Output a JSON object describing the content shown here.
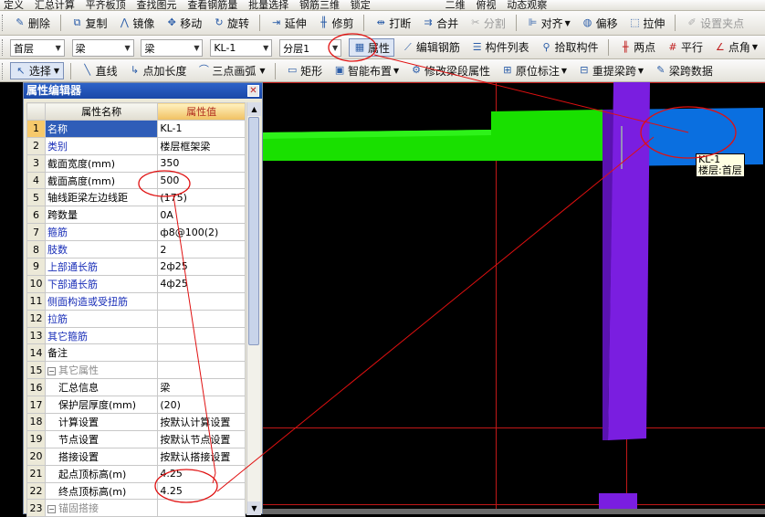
{
  "menu": [
    "定义",
    "汇总计算",
    "平齐板顶",
    "查找图元",
    "查看钢筋量",
    "批量选择",
    "钢筋三维",
    "锁定",
    "二维",
    "俯视",
    "动态观察"
  ],
  "toolbar1": {
    "delete": "删除",
    "copy": "复制",
    "mirror": "镜像",
    "move": "移动",
    "rotate": "旋转",
    "extend": "延伸",
    "trim": "修剪",
    "break": "打断",
    "merge": "合并",
    "split": "分割",
    "align": "对齐",
    "offset": "偏移",
    "stretch": "拉伸",
    "set_grip": "设置夹点"
  },
  "toolbar2": {
    "floor": "首层",
    "type1": "梁",
    "type2": "梁",
    "component": "KL-1",
    "layer": "分层1",
    "property": "属性",
    "edit_rebar": "编辑钢筋",
    "component_list": "构件列表",
    "pick": "拾取构件",
    "two_points": "两点",
    "parallel": "平行",
    "angle_point": "点角"
  },
  "toolbar3": {
    "select": "选择",
    "line": "直线",
    "point_extend": "点加长度",
    "arc": "三点画弧",
    "rect": "矩形",
    "smart": "智能布置",
    "modify_span": "修改梁段属性",
    "origin_mark": "原位标注",
    "re_span": "重提梁跨",
    "span_data": "梁跨数据"
  },
  "panel": {
    "title": "属性编辑器",
    "col_name": "属性名称",
    "col_value": "属性值",
    "rows": [
      {
        "n": "1",
        "name": "名称",
        "value": "KL-1",
        "style": "sel"
      },
      {
        "n": "2",
        "name": "类别",
        "value": "楼层框架梁",
        "style": "blue"
      },
      {
        "n": "3",
        "name": "截面宽度(mm)",
        "value": "350",
        "style": ""
      },
      {
        "n": "4",
        "name": "截面高度(mm)",
        "value": "500",
        "style": ""
      },
      {
        "n": "5",
        "name": "轴线距梁左边线距",
        "value": "(175)",
        "style": ""
      },
      {
        "n": "6",
        "name": "跨数量",
        "value": "0A",
        "style": ""
      },
      {
        "n": "7",
        "name": "箍筋",
        "value": "ф8@100(2)",
        "style": "blue"
      },
      {
        "n": "8",
        "name": "肢数",
        "value": "2",
        "style": "blue"
      },
      {
        "n": "9",
        "name": "上部通长筋",
        "value": "2ф25",
        "style": "blue"
      },
      {
        "n": "10",
        "name": "下部通长筋",
        "value": "4ф25",
        "style": "blue"
      },
      {
        "n": "11",
        "name": "侧面构造或受扭筋",
        "value": "",
        "style": "blue"
      },
      {
        "n": "12",
        "name": "拉筋",
        "value": "",
        "style": "blue"
      },
      {
        "n": "13",
        "name": "其它箍筋",
        "value": "",
        "style": "blue"
      },
      {
        "n": "14",
        "name": "备注",
        "value": "",
        "style": ""
      },
      {
        "n": "15",
        "name": "其它属性",
        "value": "",
        "style": "group"
      },
      {
        "n": "16",
        "name": "汇总信息",
        "value": "梁",
        "style": "child"
      },
      {
        "n": "17",
        "name": "保护层厚度(mm)",
        "value": "(20)",
        "style": "child"
      },
      {
        "n": "18",
        "name": "计算设置",
        "value": "按默认计算设置",
        "style": "child"
      },
      {
        "n": "19",
        "name": "节点设置",
        "value": "按默认节点设置",
        "style": "child"
      },
      {
        "n": "20",
        "name": "搭接设置",
        "value": "按默认搭接设置",
        "style": "child"
      },
      {
        "n": "21",
        "name": "起点顶标高(m)",
        "value": "4.25",
        "style": "child"
      },
      {
        "n": "22",
        "name": "终点顶标高(m)",
        "value": "4.25",
        "style": "child"
      },
      {
        "n": "23",
        "name": "锚固搭接",
        "value": "",
        "style": "group"
      }
    ]
  },
  "tooltip": {
    "line1": "KL-1",
    "line2": "楼层:首层"
  },
  "colors": {
    "beam_green": "#19e000",
    "beam_blue": "#0a6fe0",
    "column_purple": "#7a1ee0",
    "grid_red": "#c11818",
    "annotation_red": "#e01010"
  }
}
